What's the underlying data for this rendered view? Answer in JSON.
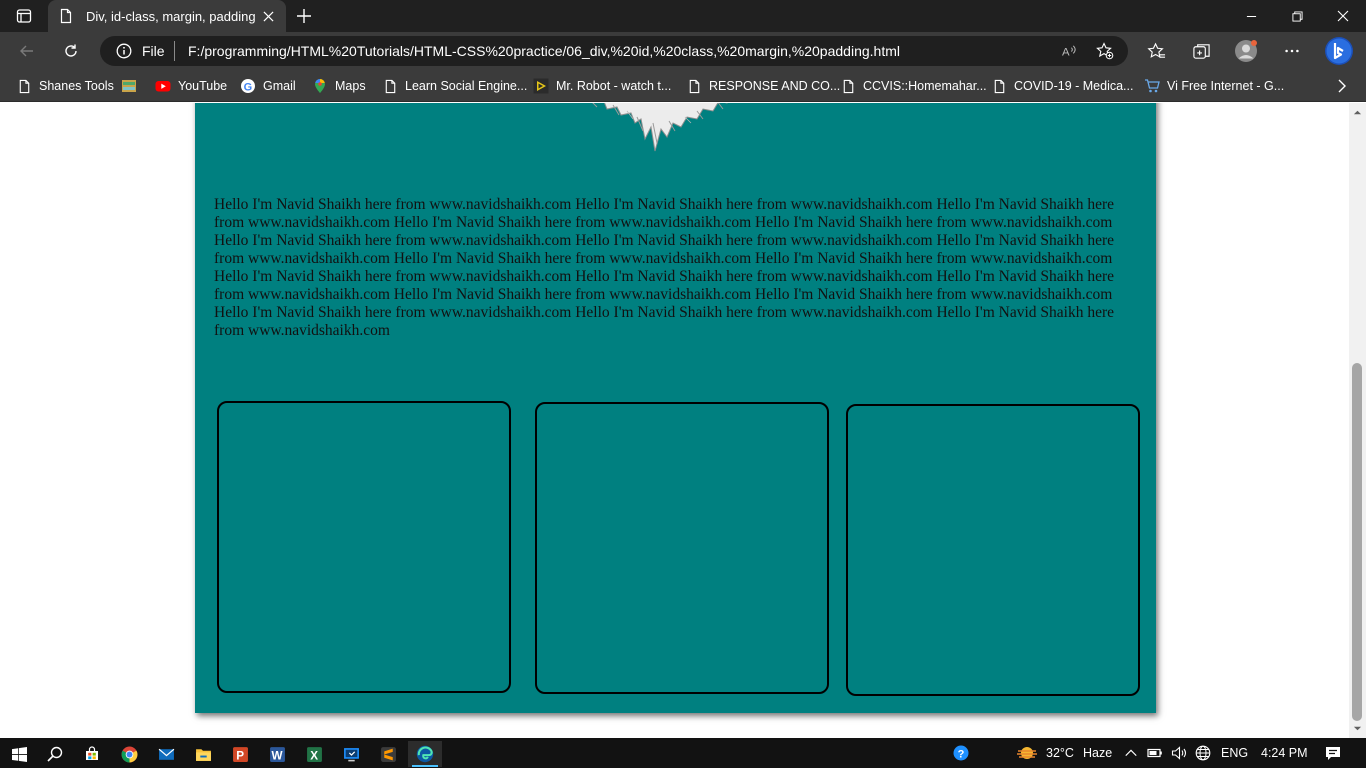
{
  "browser": {
    "tab_title": "Div, id-class, margin, padding",
    "url_scheme": "File",
    "url": "F:/programming/HTML%20Tutorials/HTML-CSS%20practice/06_div,%20id,%20class,%20margin,%20padding.html"
  },
  "bookmarks": [
    {
      "label": "Shanes Tools",
      "icon": "page-icon"
    },
    {
      "label": "",
      "icon": "image-icon"
    },
    {
      "label": "YouTube",
      "icon": "youtube-icon"
    },
    {
      "label": "Gmail",
      "icon": "google-icon"
    },
    {
      "label": "Maps",
      "icon": "maps-icon"
    },
    {
      "label": "Learn Social Engine...",
      "icon": "page-icon"
    },
    {
      "label": "Mr. Robot - watch t...",
      "icon": "play-icon"
    },
    {
      "label": "RESPONSE AND CO...",
      "icon": "page-icon"
    },
    {
      "label": "CCVIS::Homemahar...",
      "icon": "page-icon"
    },
    {
      "label": "COVID-19 - Medica...",
      "icon": "page-icon"
    },
    {
      "label": "Vi Free Internet - G...",
      "icon": "cart-icon"
    }
  ],
  "page": {
    "paragraph": "Hello I'm Navid Shaikh here from www.navidshaikh.com Hello I'm Navid Shaikh here from www.navidshaikh.com Hello I'm Navid Shaikh here from www.navidshaikh.com Hello I'm Navid Shaikh here from www.navidshaikh.com Hello I'm Navid Shaikh here from www.navidshaikh.com Hello I'm Navid Shaikh here from www.navidshaikh.com Hello I'm Navid Shaikh here from www.navidshaikh.com Hello I'm Navid Shaikh here from www.navidshaikh.com Hello I'm Navid Shaikh here from www.navidshaikh.com Hello I'm Navid Shaikh here from www.navidshaikh.com Hello I'm Navid Shaikh here from www.navidshaikh.com Hello I'm Navid Shaikh here from www.navidshaikh.com Hello I'm Navid Shaikh here from www.navidshaikh.com Hello I'm Navid Shaikh here from www.navidshaikh.com Hello I'm Navid Shaikh here from www.navidshaikh.com Hello I'm Navid Shaikh here from www.navidshaikh.com Hello I'm Navid Shaikh here from www.navidshaikh.com Hello I'm Navid Shaikh here from www.navidshaikh.com",
    "background_color": "#008080",
    "box_count": 3
  },
  "taskbar": {
    "apps": [
      "start-icon",
      "search-icon",
      "store-icon",
      "chrome-icon",
      "mail-icon",
      "file-explorer-icon",
      "powerpoint-icon",
      "word-icon",
      "excel-icon",
      "screen-app-icon",
      "sublime-icon",
      "edge-icon"
    ],
    "weather_temp": "32°C",
    "weather_desc": "Haze",
    "language": "ENG",
    "time": "4:24 PM"
  },
  "colors": {
    "titlebar": "#202020",
    "toolbar": "#3b3b3b",
    "accent": "#4cc2ff"
  }
}
